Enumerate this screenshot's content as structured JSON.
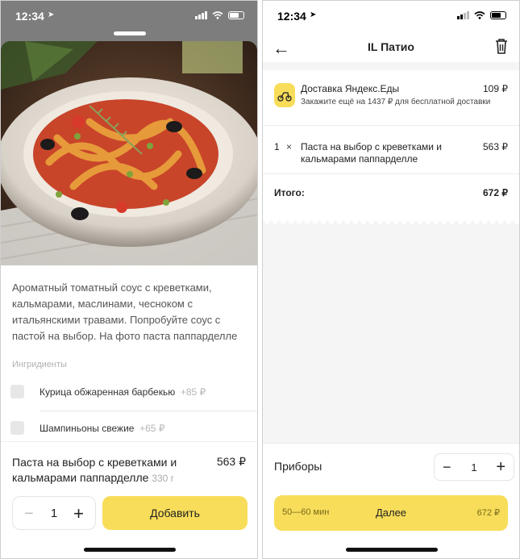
{
  "left_screen": {
    "status_bar": {
      "time": "12:34"
    },
    "product": {
      "description": "Ароматный томатный соус с креветками, кальмарами, маслинами, чесноком с итальянскими травами. Попробуйте соус с пастой на выбор. На фото паста паппарделле",
      "ingredients_title": "Ингридиенты",
      "ingredients": [
        {
          "name": "Курица обжаренная барбекью",
          "price": "+85 ₽"
        },
        {
          "name": "Шампиньоны свежие",
          "price": "+65 ₽"
        }
      ],
      "name": "Паста на выбор с креветками и кальмарами паппарделле",
      "weight": "330 г",
      "price": "563 ₽",
      "quantity": "1",
      "add_button": "Добавить"
    }
  },
  "right_screen": {
    "status_bar": {
      "time": "12:34"
    },
    "nav": {
      "title": "IL Патио"
    },
    "delivery": {
      "title": "Доставка Яндекс.Еды",
      "price": "109 ₽",
      "note": "Закажите ещё на 1437 ₽ для бесплатной доставки"
    },
    "item": {
      "quantity": "1",
      "times": "×",
      "name": "Паста на выбор с креветками и кальмарами паппарделле",
      "price": "563 ₽"
    },
    "total": {
      "label": "Итого:",
      "value": "672 ₽"
    },
    "cutlery": {
      "label": "Приборы",
      "quantity": "1"
    },
    "next_button": {
      "eta": "50—60 мин",
      "label": "Далее",
      "sum": "672 ₽"
    }
  },
  "colors": {
    "accent": "#f7dd5a",
    "background_right": "#f5f5f5"
  },
  "icons": [
    "location-arrow-icon",
    "signal-icon",
    "wifi-icon",
    "battery-icon",
    "back-arrow-icon",
    "trash-icon",
    "scooter-icon",
    "minus-icon",
    "plus-icon"
  ]
}
